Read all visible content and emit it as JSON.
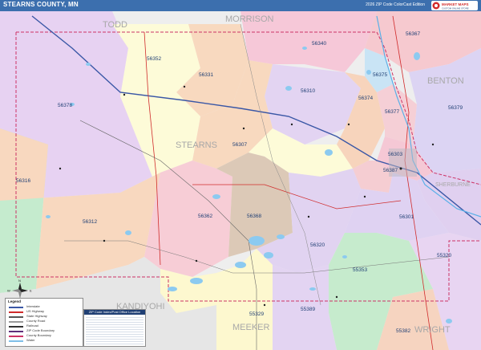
{
  "header": {
    "title": "STEARNS COUNTY, MN",
    "edition": "2026 ZIP Code ColorCast Edition",
    "logo_text": "MARKET MAPS",
    "logo_sub": "CUSTOM ONLINE STORE"
  },
  "counties": [
    {
      "name": "TODD"
    },
    {
      "name": "MORRISON"
    },
    {
      "name": "BENTON"
    },
    {
      "name": "STEARNS"
    },
    {
      "name": "SHERBURNE"
    },
    {
      "name": "KANDIYOHI"
    },
    {
      "name": "MEEKER"
    },
    {
      "name": "WRIGHT"
    }
  ],
  "zips": [
    {
      "code": "56367",
      "fill": "#f6c9cf"
    },
    {
      "code": "56340",
      "fill": "#f6c8d8"
    },
    {
      "code": "56352",
      "fill": "#fdfbd8"
    },
    {
      "code": "56331",
      "fill": "#f8d9bf"
    },
    {
      "code": "56378",
      "fill": "#e7d2f2"
    },
    {
      "code": "56375",
      "fill": "#c9e4f5"
    },
    {
      "code": "56379",
      "fill": "#dcd4f3"
    },
    {
      "code": "56310",
      "fill": "#e3d4f2"
    },
    {
      "code": "56374",
      "fill": "#f7d4bc"
    },
    {
      "code": "56377",
      "fill": "#f5cfd6"
    },
    {
      "code": "56307",
      "fill": "#f8d9bf"
    },
    {
      "code": "56303",
      "fill": "#f5c8d5"
    },
    {
      "code": "56387",
      "fill": "#f5cdd2"
    },
    {
      "code": "56316",
      "fill": "#c5ebce"
    },
    {
      "code": "56312",
      "fill": "#f8d8bf"
    },
    {
      "code": "56362",
      "fill": "#f7cdd6"
    },
    {
      "code": "56368",
      "fill": "#dcc9b7"
    },
    {
      "code": "56301",
      "fill": "#dfd2f2"
    },
    {
      "code": "56320",
      "fill": "#e1d3f1"
    },
    {
      "code": "55320",
      "fill": "#e8d5f2"
    },
    {
      "code": "55353",
      "fill": "#c6ebcd"
    },
    {
      "code": "55329",
      "fill": "#fdf8cf"
    },
    {
      "code": "55389",
      "fill": "#e3d4f2"
    },
    {
      "code": "55382",
      "fill": "#f6d4c0"
    }
  ],
  "compass": {
    "n": "N",
    "s": "S",
    "e": "E",
    "w": "W"
  },
  "legend": {
    "title": "Legend",
    "items": [
      {
        "label": "Interstate",
        "color": "#3a57a6"
      },
      {
        "label": "US Highway",
        "color": "#d02b2b"
      },
      {
        "label": "State Highway",
        "color": "#555555"
      },
      {
        "label": "County Road",
        "color": "#9a9a9a"
      },
      {
        "label": "Railroad",
        "color": "#333333"
      },
      {
        "label": "ZIP Code Boundary",
        "color": "#5e2f7a"
      },
      {
        "label": "County Boundary",
        "color": "#cc3366"
      },
      {
        "label": "Water",
        "color": "#7fbfe8"
      }
    ]
  },
  "index": {
    "title": "ZIP Code Index/Post Office Location"
  }
}
